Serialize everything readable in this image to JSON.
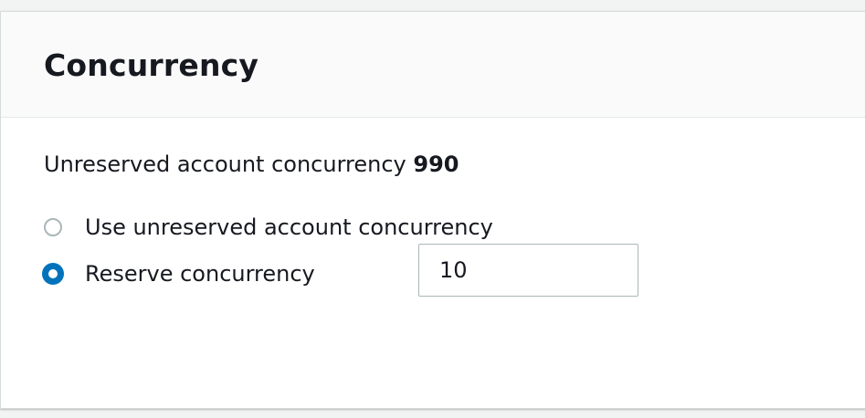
{
  "panel": {
    "title": "Concurrency",
    "unreserved_label": "Unreserved account concurrency",
    "unreserved_value": "990",
    "options": [
      {
        "label": "Use unreserved account concurrency",
        "selected": false
      },
      {
        "label": "Reserve concurrency",
        "selected": true
      }
    ],
    "reserve_input_value": "10"
  },
  "colors": {
    "accent": "#0073bb",
    "header_bg": "#fafafa",
    "border": "#d5dbdb"
  }
}
